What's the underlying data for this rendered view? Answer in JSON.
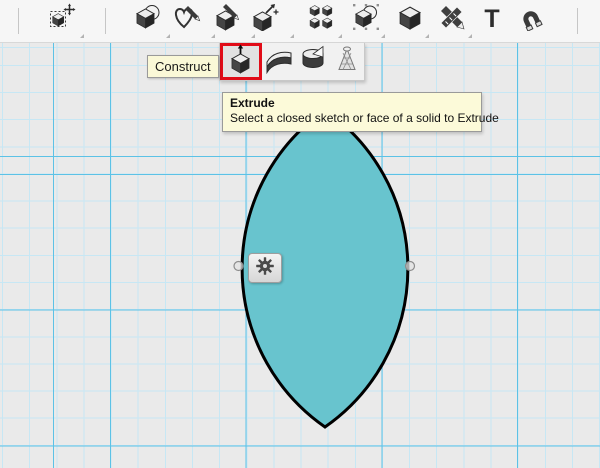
{
  "toolbar": {
    "tools": [
      {
        "id": "move",
        "icon": "move-icon"
      },
      {
        "id": "primitives",
        "icon": "primitives-icon"
      },
      {
        "id": "sketch",
        "icon": "sketch-icon"
      },
      {
        "id": "construct",
        "icon": "construct-icon"
      },
      {
        "id": "transform",
        "icon": "transform-icon"
      },
      {
        "id": "pattern",
        "icon": "pattern-icon"
      },
      {
        "id": "combine",
        "icon": "combine-icon"
      },
      {
        "id": "modify",
        "icon": "modify-icon"
      },
      {
        "id": "measure",
        "icon": "measure-icon"
      },
      {
        "id": "text",
        "icon": "text-icon"
      },
      {
        "id": "snap",
        "icon": "snap-icon"
      }
    ],
    "text_tool_glyph": "T"
  },
  "construct_label": {
    "text": "Construct"
  },
  "construct_menu": {
    "items": [
      {
        "id": "extrude",
        "icon": "extrude-icon",
        "selected": true
      },
      {
        "id": "sweep",
        "icon": "sweep-icon",
        "selected": false
      },
      {
        "id": "revolve",
        "icon": "revolve-icon",
        "selected": false
      },
      {
        "id": "loft",
        "icon": "loft-icon",
        "selected": false
      }
    ]
  },
  "tooltip": {
    "title": "Extrude",
    "description": "Select a closed sketch or face of a solid to Extrude"
  },
  "canvas": {
    "object": "closed-sketch-lens",
    "gear_button_icon": "gear-icon",
    "handles": [
      "left-vertex-handle",
      "right-vertex-handle"
    ]
  },
  "colors": {
    "shape_fill": "#68c4ce",
    "shape_stroke": "#000000",
    "highlight_red": "#e10c18",
    "canvas_bg": "#eaeaea",
    "grid_minor": "#c7e7f4",
    "grid_major": "#5cc2e6",
    "tooltip_bg": "#fcfad9",
    "label_bg": "#faf8d7"
  }
}
